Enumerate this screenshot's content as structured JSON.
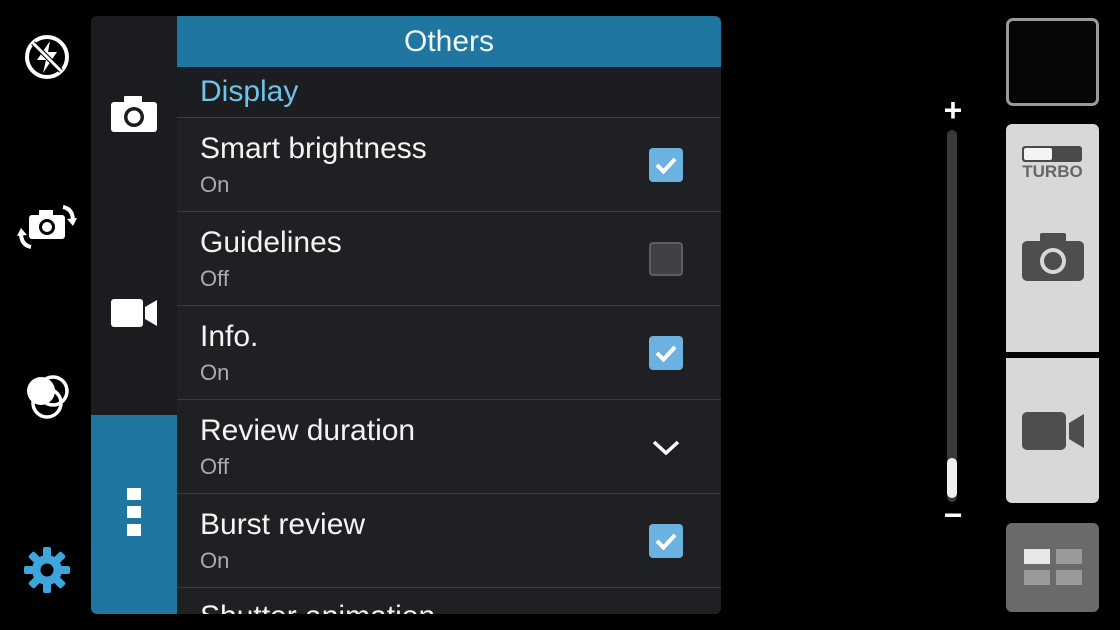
{
  "left_rail": {
    "icons": [
      "flash-icon",
      "switch-camera-icon",
      "effects-icon",
      "settings-icon"
    ],
    "accent": "#3fa6dc"
  },
  "tabs": {
    "items": [
      "camera-tab",
      "video-tab",
      "more-tab"
    ],
    "active": "more-tab"
  },
  "panel": {
    "title": "Others",
    "section": "Display",
    "rows": [
      {
        "title": "Smart brightness",
        "value": "On",
        "control": "checkbox",
        "checked": true
      },
      {
        "title": "Guidelines",
        "value": "Off",
        "control": "checkbox",
        "checked": false
      },
      {
        "title": "Info.",
        "value": "On",
        "control": "checkbox",
        "checked": true
      },
      {
        "title": "Review duration",
        "value": "Off",
        "control": "dropdown"
      },
      {
        "title": "Burst review",
        "value": "On",
        "control": "checkbox",
        "checked": true
      }
    ],
    "partial_row_title": "Shutter animation"
  },
  "zoom": {
    "plus": "+",
    "minus": "−",
    "level": 0.1
  },
  "right": {
    "turbo_label": "TURBO"
  },
  "colors": {
    "header": "#1f76a0",
    "section_text": "#6fc2e9",
    "check_on": "#6cb2e0"
  }
}
